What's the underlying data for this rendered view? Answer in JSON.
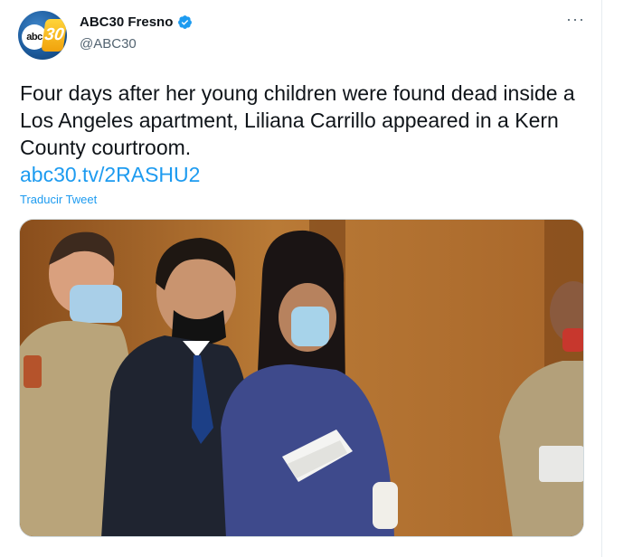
{
  "account": {
    "display_name": "ABC30 Fresno",
    "handle": "@ABC30",
    "verified": true,
    "avatar": {
      "logo_text": "abc",
      "logo_number": "30"
    }
  },
  "tweet": {
    "text": "Four days after her young children were found dead inside a Los Angeles apartment, Liliana Carrillo appeared in a Kern County courtroom.",
    "link": "abc30.tv/2RASHU2",
    "translate_label": "Traducir Tweet",
    "more_label": "···"
  },
  "media": {
    "icon": "courtroom-photo"
  },
  "colors": {
    "link": "#1d9bf0",
    "verified": "#1d9bf0"
  }
}
